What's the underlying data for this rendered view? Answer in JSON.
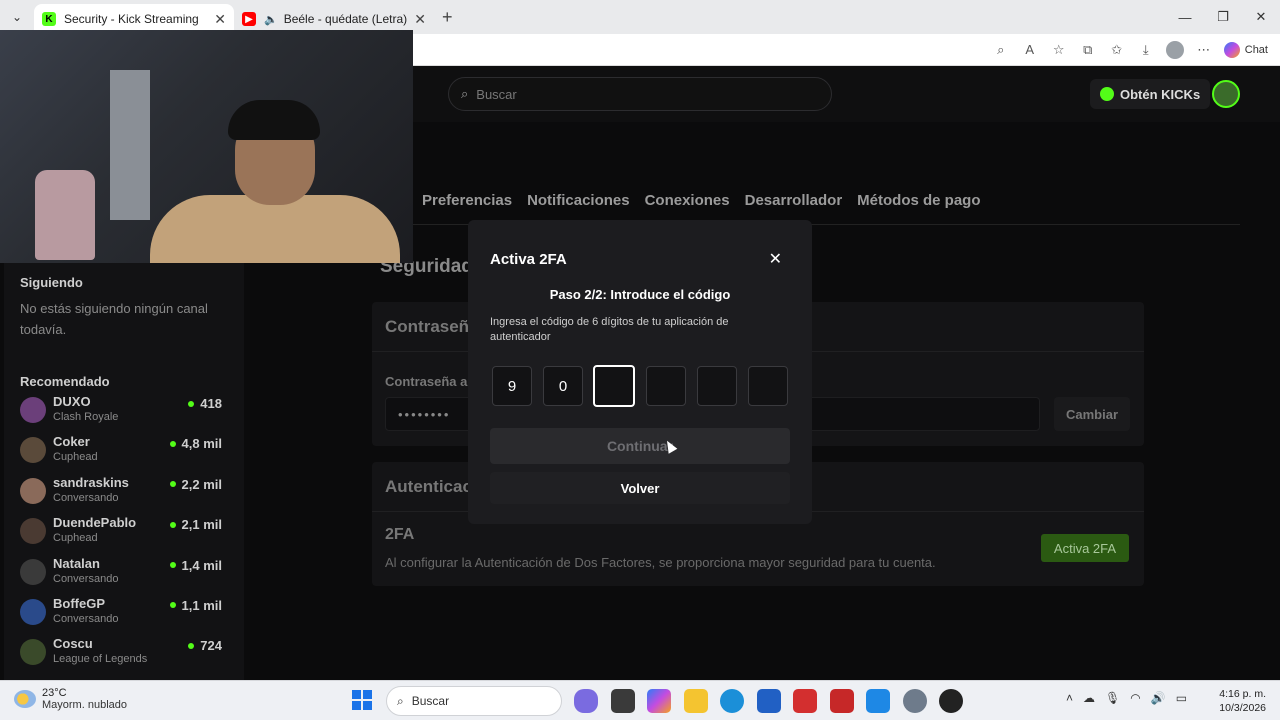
{
  "browser": {
    "tabs": [
      {
        "title": "Security - Kick Streaming",
        "active": true
      },
      {
        "title": "Beéle - quédate (Letra) - YouT",
        "active": false
      }
    ],
    "chat_label": "Chat"
  },
  "site": {
    "search_placeholder": "Buscar",
    "kicks_button": "Obtén KICKs"
  },
  "sidebar": {
    "following_title": "Siguiendo",
    "following_empty": "No estás siguiendo ningún canal todavía.",
    "recommended_title": "Recomendado",
    "channels": [
      {
        "name": "DUXO",
        "category": "Clash Royale",
        "viewers": "418"
      },
      {
        "name": "Coker",
        "category": "Cuphead",
        "viewers": "4,8 mil"
      },
      {
        "name": "sandraskins",
        "category": "Conversando",
        "viewers": "2,2 mil"
      },
      {
        "name": "DuendePablo",
        "category": "Cuphead",
        "viewers": "2,1 mil"
      },
      {
        "name": "Natalan",
        "category": "Conversando",
        "viewers": "1,4 mil"
      },
      {
        "name": "BoffeGP",
        "category": "Conversando",
        "viewers": "1,1 mil"
      },
      {
        "name": "Coscu",
        "category": "League of Legends",
        "viewers": "724"
      }
    ]
  },
  "settings": {
    "tabs": [
      "Preferencias",
      "Notificaciones",
      "Conexiones",
      "Desarrollador",
      "Métodos de pago"
    ],
    "section_title": "Seguridad",
    "password_card_title": "Contraseña",
    "password_label": "Contraseña a",
    "password_value": "••••••••",
    "change_button": "Cambiar",
    "auth_card_title": "Autenticac",
    "twofa_title": "2FA",
    "twofa_desc": "Al configurar la Autenticación de Dos Factores, se proporciona mayor seguridad para tu cuenta.",
    "twofa_button": "Activa 2FA"
  },
  "modal": {
    "title": "Activa 2FA",
    "step": "Paso 2/2: Introduce el código",
    "description": "Ingresa el código de 6 dígitos de tu aplicación de autenticador",
    "digits": [
      "9",
      "0",
      "",
      "",
      "",
      ""
    ],
    "continue_button": "Continuar",
    "back_button": "Volver"
  },
  "taskbar": {
    "temperature": "23°C",
    "weather": "Mayorm. nublado",
    "search_placeholder": "Buscar",
    "time": "4:16 p. m.",
    "date": "10/3/2026"
  }
}
